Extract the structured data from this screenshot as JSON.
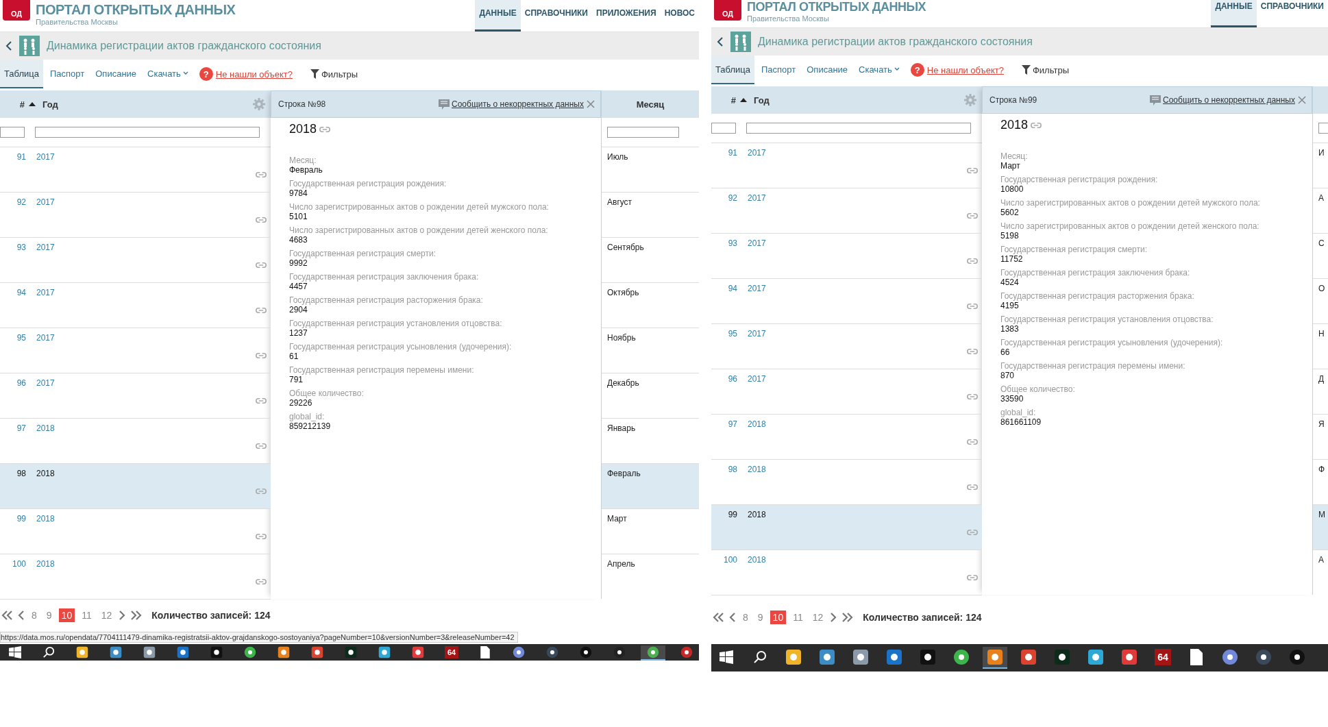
{
  "screenshots": [
    {
      "header": {
        "logo_text": "ОД",
        "title": "ПОРТАЛ ОТКРЫТЫХ ДАННЫХ",
        "subtitle": "Правительства Москвы",
        "nav": [
          {
            "label": "ДАННЫЕ",
            "selected": true
          },
          {
            "label": "СПРАВОЧНИКИ",
            "selected": false
          },
          {
            "label": "ПРИЛОЖЕНИЯ",
            "selected": false
          },
          {
            "label": "НОВОС",
            "selected": false
          }
        ]
      },
      "dataset_title": "Динамика регистрации актов гражданского состояния",
      "tabs": [
        {
          "label": "Таблица",
          "selected": true,
          "kind": "tab"
        },
        {
          "label": "Паспорт",
          "selected": false,
          "kind": "tab"
        },
        {
          "label": "Описание",
          "selected": false,
          "kind": "tab"
        },
        {
          "label": "Скачать",
          "selected": false,
          "kind": "dropdown"
        }
      ],
      "help_icon": "?",
      "help_link": "Не нашли объект?",
      "filters": "Фильтры",
      "table": {
        "columns": [
          "#",
          "Год"
        ],
        "month_column": "Месяц",
        "rows": [
          {
            "number": "91",
            "year": "2017",
            "month": "Июль",
            "selected": false
          },
          {
            "number": "92",
            "year": "2017",
            "month": "Август",
            "selected": false
          },
          {
            "number": "93",
            "year": "2017",
            "month": "Сентябрь",
            "selected": false
          },
          {
            "number": "94",
            "year": "2017",
            "month": "Октябрь",
            "selected": false
          },
          {
            "number": "95",
            "year": "2017",
            "month": "Ноябрь",
            "selected": false
          },
          {
            "number": "96",
            "year": "2017",
            "month": "Декабрь",
            "selected": false
          },
          {
            "number": "97",
            "year": "2018",
            "month": "Январь",
            "selected": false
          },
          {
            "number": "98",
            "year": "2018",
            "month": "Февраль",
            "selected": true
          },
          {
            "number": "99",
            "year": "2018",
            "month": "Март",
            "selected": false
          },
          {
            "number": "100",
            "year": "2018",
            "month": "Апрель",
            "selected": false
          }
        ]
      },
      "detail": {
        "title": "Строка №98",
        "report_link": "Сообщить о некорректных данных",
        "heading": "2018",
        "fields": [
          {
            "label": "Месяц:",
            "value": "Февраль"
          },
          {
            "label": "Государственная регистрация рождения:",
            "value": "9784"
          },
          {
            "label": "Число зарегистрированных актов о рождении детей мужского пола:",
            "value": "5101"
          },
          {
            "label": "Число зарегистрированных актов о рождении детей женского пола:",
            "value": "4683"
          },
          {
            "label": "Государственная регистрация смерти:",
            "value": "9992"
          },
          {
            "label": "Государственная регистрация заключения брака:",
            "value": "4457"
          },
          {
            "label": "Государственная регистрация расторжения брака:",
            "value": "2904"
          },
          {
            "label": "Государственная регистрация установления отцовства:",
            "value": "1237"
          },
          {
            "label": "Государственная регистрация усыновления (удочерения):",
            "value": "61"
          },
          {
            "label": "Государственная регистрация перемены имени:",
            "value": "791"
          },
          {
            "label": "Общее количество:",
            "value": "29226"
          },
          {
            "label": "global_id:",
            "value": "859212139"
          }
        ]
      },
      "pagination": {
        "pages": [
          {
            "label": "8",
            "selected": false
          },
          {
            "label": "9",
            "selected": false
          },
          {
            "label": "10",
            "selected": true
          },
          {
            "label": "11",
            "selected": false
          },
          {
            "label": "12",
            "selected": false
          }
        ],
        "total": "Количество записей: 124"
      },
      "status_url": "https://data.mos.ru/opendata/7704111479-dinamika-registratsii-aktov-grajdanskogo-sostoyaniya?pageNumber=10&versionNumber=3&releaseNumber=42",
      "taskbar": {
        "icons": [
          {
            "kind": "windows",
            "active": false
          },
          {
            "kind": "search",
            "active": false
          },
          {
            "kind": "square",
            "color": "#f0b429",
            "active": false
          },
          {
            "kind": "square",
            "color": "#3c8dc5",
            "active": false
          },
          {
            "kind": "square",
            "color": "#8a9aa8",
            "active": false
          },
          {
            "kind": "square",
            "color": "#1a73c9",
            "active": false
          },
          {
            "kind": "square",
            "color": "#111111",
            "active": false
          },
          {
            "kind": "circle",
            "color": "#3cb54a",
            "active": false
          },
          {
            "kind": "square",
            "color": "#e8811c",
            "active": false
          },
          {
            "kind": "square",
            "color": "#d9432f",
            "active": false
          },
          {
            "kind": "square",
            "color": "#0d2b1a",
            "active": false
          },
          {
            "kind": "square",
            "color": "#2ea9d6",
            "active": false
          },
          {
            "kind": "square",
            "color": "#e03a3a",
            "active": false
          },
          {
            "kind": "label",
            "label": "64",
            "color": "#a31515",
            "active": false
          },
          {
            "kind": "file",
            "active": false
          },
          {
            "kind": "circle",
            "color": "#7289da",
            "active": false
          },
          {
            "kind": "circle",
            "color": "#3a4a5a",
            "active": false
          },
          {
            "kind": "circle",
            "color": "#111111",
            "active": false
          },
          {
            "kind": "circle",
            "color": "#222222",
            "active": false
          },
          {
            "kind": "circle",
            "color": "#4caf50",
            "active": true
          },
          {
            "kind": "circle",
            "color": "#c62828",
            "active": false
          }
        ]
      }
    },
    {
      "header": {
        "logo_text": "ОД",
        "title": "ПОРТАЛ ОТКРЫТЫХ ДАННЫХ",
        "subtitle": "Правительства Москвы",
        "nav": [
          {
            "label": "ДАННЫЕ",
            "selected": true
          },
          {
            "label": "СПРАВОЧНИКИ",
            "selected": false
          }
        ]
      },
      "dataset_title": "Динамика регистрации актов гражданского состояния",
      "tabs": [
        {
          "label": "Таблица",
          "selected": true,
          "kind": "tab"
        },
        {
          "label": "Паспорт",
          "selected": false,
          "kind": "tab"
        },
        {
          "label": "Описание",
          "selected": false,
          "kind": "tab"
        },
        {
          "label": "Скачать",
          "selected": false,
          "kind": "dropdown"
        }
      ],
      "help_icon": "?",
      "help_link": "Не нашли объект?",
      "filters": "Фильтры",
      "table": {
        "columns": [
          "#",
          "Год"
        ],
        "rows": [
          {
            "number": "91",
            "year": "2017",
            "month": "И",
            "selected": false
          },
          {
            "number": "92",
            "year": "2017",
            "month": "А",
            "selected": false
          },
          {
            "number": "93",
            "year": "2017",
            "month": "С",
            "selected": false
          },
          {
            "number": "94",
            "year": "2017",
            "month": "О",
            "selected": false
          },
          {
            "number": "95",
            "year": "2017",
            "month": "Н",
            "selected": false
          },
          {
            "number": "96",
            "year": "2017",
            "month": "Д",
            "selected": false
          },
          {
            "number": "97",
            "year": "2018",
            "month": "Я",
            "selected": false
          },
          {
            "number": "98",
            "year": "2018",
            "month": "Ф",
            "selected": false
          },
          {
            "number": "99",
            "year": "2018",
            "month": "М",
            "selected": true
          },
          {
            "number": "100",
            "year": "2018",
            "month": "А",
            "selected": false
          }
        ]
      },
      "detail": {
        "title": "Строка №99",
        "report_link": "Сообщить о некорректных данных",
        "heading": "2018",
        "fields": [
          {
            "label": "Месяц:",
            "value": "Март"
          },
          {
            "label": "Государственная регистрация рождения:",
            "value": "10800"
          },
          {
            "label": "Число зарегистрированных актов о рождении детей мужского пола:",
            "value": "5602"
          },
          {
            "label": "Число зарегистрированных актов о рождении детей женского пола:",
            "value": "5198"
          },
          {
            "label": "Государственная регистрация смерти:",
            "value": "11752"
          },
          {
            "label": "Государственная регистрация заключения брака:",
            "value": "4524"
          },
          {
            "label": "Государственная регистрация расторжения брака:",
            "value": "4195"
          },
          {
            "label": "Государственная регистрация установления отцовства:",
            "value": "1383"
          },
          {
            "label": "Государственная регистрация усыновления (удочерения):",
            "value": "66"
          },
          {
            "label": "Государственная регистрация перемены имени:",
            "value": "870"
          },
          {
            "label": "Общее количество:",
            "value": "33590"
          },
          {
            "label": "global_id:",
            "value": "861661109"
          }
        ]
      },
      "pagination": {
        "pages": [
          {
            "label": "8",
            "selected": false
          },
          {
            "label": "9",
            "selected": false
          },
          {
            "label": "10",
            "selected": true
          },
          {
            "label": "11",
            "selected": false
          },
          {
            "label": "12",
            "selected": false
          }
        ],
        "total": "Количество записей: 124"
      },
      "taskbar": {
        "icons": [
          {
            "kind": "windows",
            "active": false
          },
          {
            "kind": "search",
            "active": false
          },
          {
            "kind": "square",
            "color": "#f0b429",
            "active": false
          },
          {
            "kind": "square",
            "color": "#3c8dc5",
            "active": false
          },
          {
            "kind": "square",
            "color": "#8a9aa8",
            "active": false
          },
          {
            "kind": "square",
            "color": "#1a73c9",
            "active": false
          },
          {
            "kind": "square",
            "color": "#111111",
            "active": false
          },
          {
            "kind": "circle",
            "color": "#3cb54a",
            "active": false
          },
          {
            "kind": "square",
            "color": "#e8811c",
            "active": true
          },
          {
            "kind": "square",
            "color": "#d9432f",
            "active": false
          },
          {
            "kind": "square",
            "color": "#0d2b1a",
            "active": false
          },
          {
            "kind": "square",
            "color": "#2ea9d6",
            "active": false
          },
          {
            "kind": "square",
            "color": "#e03a3a",
            "active": false
          },
          {
            "kind": "label",
            "label": "64",
            "color": "#a31515",
            "active": false
          },
          {
            "kind": "file",
            "active": false
          },
          {
            "kind": "circle",
            "color": "#7289da",
            "active": false
          },
          {
            "kind": "circle",
            "color": "#3a4a5a",
            "active": false
          },
          {
            "kind": "circle",
            "color": "#111111",
            "active": false
          }
        ]
      }
    }
  ]
}
